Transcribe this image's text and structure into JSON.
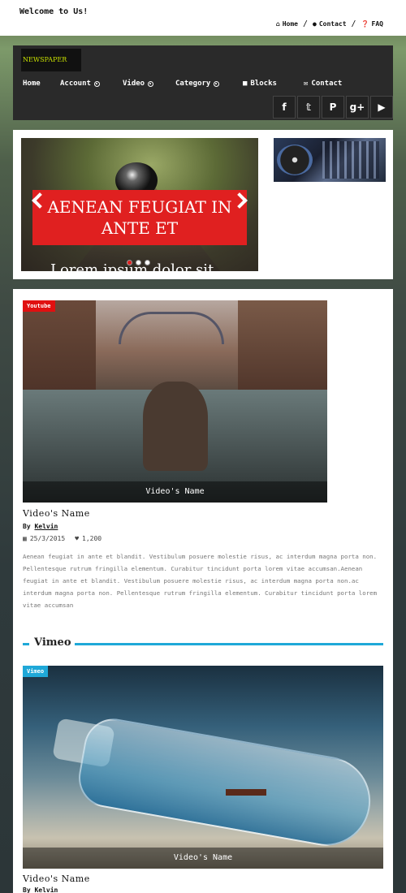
{
  "topbar": {
    "welcome": "Welcome to Us!",
    "links": [
      {
        "label": "Home",
        "icon": "home-icon"
      },
      {
        "label": "Contact",
        "icon": "comments-icon"
      },
      {
        "label": "FAQ",
        "icon": "question-icon"
      }
    ],
    "separator": "/"
  },
  "header": {
    "logo": "NEWSPAPER",
    "nav": [
      {
        "label": "Home",
        "has_dropdown": false
      },
      {
        "label": "Account",
        "has_dropdown": true
      },
      {
        "label": "Video",
        "has_dropdown": true
      },
      {
        "label": "Category",
        "has_dropdown": true
      },
      {
        "label": "Blocks",
        "icon": "cubes-icon",
        "has_dropdown": false
      },
      {
        "label": "Contact",
        "icon": "envelope-icon",
        "has_dropdown": false
      }
    ],
    "social": [
      "f",
      "t",
      "p",
      "g+",
      "yt"
    ]
  },
  "slider": {
    "caption": "AENEAN FEUGIAT IN ANTE ET",
    "subtext": "Lorem ipsum dolor sit",
    "dots": 3,
    "active_dot": 0
  },
  "post1": {
    "badge": "Youtube",
    "video_name": "Video's Name",
    "title": "Video's Name",
    "by_label": "By",
    "author": "Kelvin",
    "date": "25/3/2015",
    "likes": "1,200",
    "body": "Aenean feugiat in ante et blandit. Vestibulum posuere molestie risus, ac interdum magna porta non. Pellentesque rutrum fringilla elementum. Curabitur tincidunt porta lorem vitae accumsan.Aenean feugiat in ante et blandit. Vestibulum posuere molestie risus, ac interdum magna porta non.ac interdum magna porta non. Pellentesque rutrum fringilla elementum. Curabitur tincidunt porta lorem vitae accumsan"
  },
  "section": {
    "title": "Vimeo"
  },
  "post2": {
    "badge": "Vimeo",
    "video_name": "Video's Name",
    "title": "Video's Name",
    "by_label": "By",
    "author": "Kelvin"
  },
  "colors": {
    "accent_red": "#e01010",
    "accent_blue": "#1fa8d8"
  }
}
